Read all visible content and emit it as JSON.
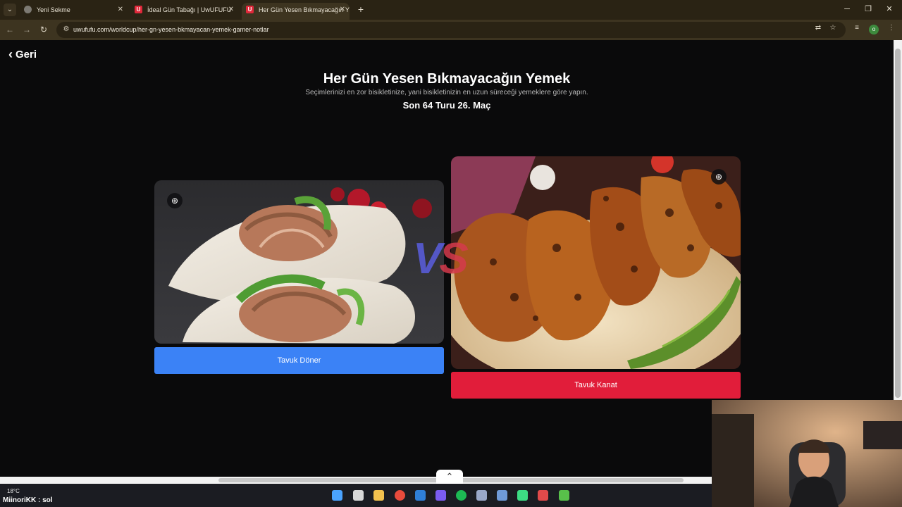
{
  "browser": {
    "tabs": [
      {
        "title": "Yeni Sekme",
        "favicon": "globe-icon",
        "active": false
      },
      {
        "title": "İdeal Gün Tabağı | UwUFUFU",
        "favicon": "uwufufu-icon",
        "active": false
      },
      {
        "title": "Her Gün Yesen Bıkmayacağın Y",
        "favicon": "uwufufu-icon",
        "active": true
      }
    ],
    "favicon_letter": "U",
    "url": "uwufufu.com/worldcup/her-gn-yesen-bkmayacan-yemek-gamer-notlar",
    "profile_initial": "o"
  },
  "page": {
    "back_label": "Geri",
    "title": "Her Gün Yesen Bıkmayacağın Yemek",
    "subtitle": "Seçimlerinizi en zor bisikletinize, yani bisikletinizin en uzun süreceği yemeklere göre yapın.",
    "round_info": "Son 64 Turu 26. Maç",
    "vs_v": "V",
    "vs_s": "S",
    "left_choice": {
      "label": "Tavuk Döner",
      "color": "#3b82f6"
    },
    "right_choice": {
      "label": "Tavuk Kanat",
      "color": "#e11d3a"
    }
  },
  "taskbar": {
    "weather": "18°C",
    "chat": "MiinoriKK : sol"
  }
}
